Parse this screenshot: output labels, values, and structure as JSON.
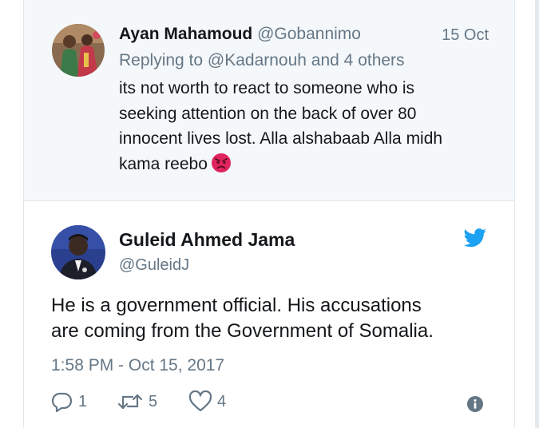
{
  "reply": {
    "author_name": "Ayan Mahamoud",
    "author_handle": "@Gobannimo",
    "date": "15 Oct",
    "replying_to": "Replying to @Kadarnouh and 4 others",
    "text_lines": [
      "its not worth to react to someone who is",
      "seeking attention on the back of over 80",
      "innocent lives lost. Alla alshabaab Alla midh",
      "kama reebo"
    ],
    "emoji_icon": "angry-face-icon"
  },
  "tweet": {
    "author_name": "Guleid Ahmed Jama",
    "author_handle": "@GuleidJ",
    "text_lines": [
      "He is a government official. His accusations",
      "are coming from the Government of Somalia."
    ],
    "timestamp": "1:58 PM - Oct 15, 2017",
    "actions": {
      "reply_count": "1",
      "retweet_count": "5",
      "like_count": "4"
    },
    "icons": [
      "twitter-bird-icon",
      "reply-icon",
      "retweet-icon",
      "heart-icon",
      "info-icon"
    ]
  },
  "colors": {
    "reply_background": "#f5f8fa",
    "text_primary": "#14171a",
    "text_secondary": "#657786",
    "twitter_blue": "#1da1f2",
    "divider": "#e1e8ed",
    "angry_emoji": "#e0245e"
  }
}
